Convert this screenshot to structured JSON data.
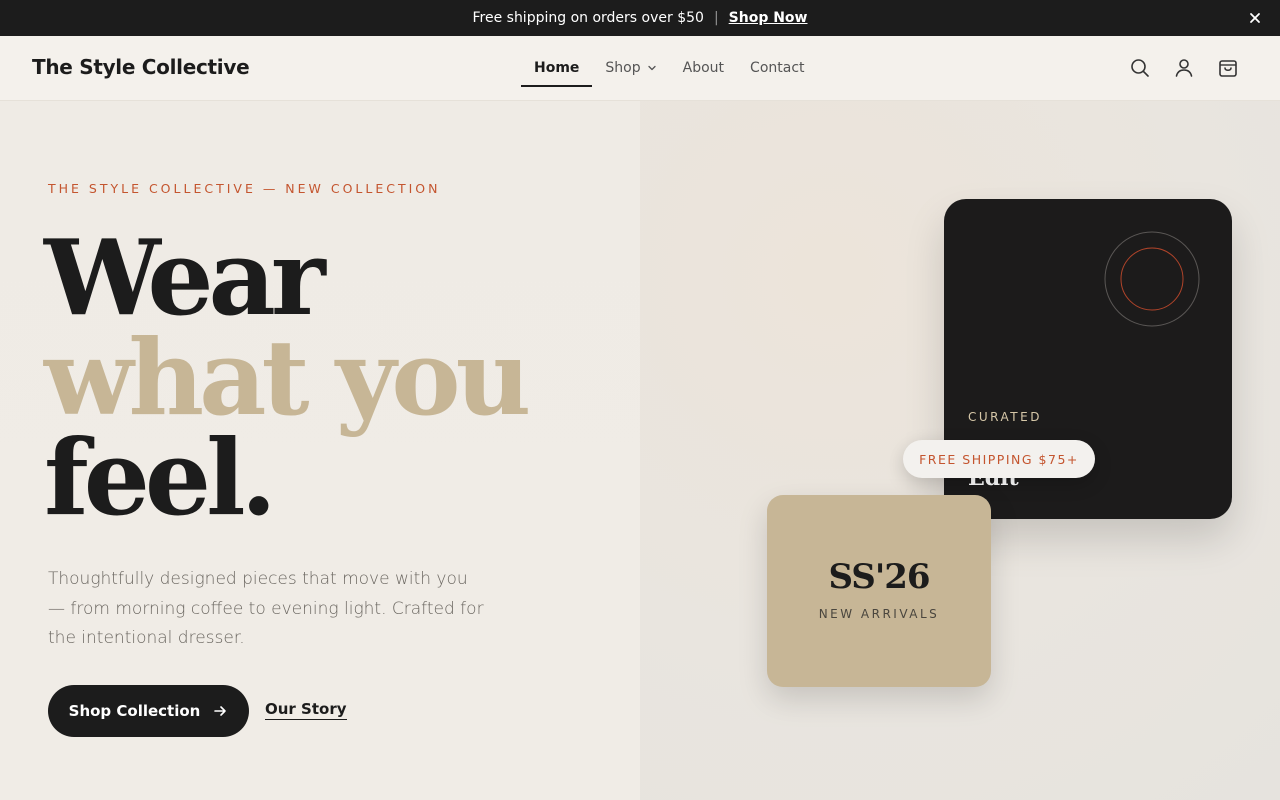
{
  "announcement": {
    "text": "Free shipping on orders over $50",
    "separator": "|",
    "link_label": "Shop Now"
  },
  "header": {
    "brand": "The Style Collective",
    "nav": [
      {
        "label": "Home",
        "active": true
      },
      {
        "label": "Shop",
        "has_dropdown": true
      },
      {
        "label": "About"
      },
      {
        "label": "Contact"
      }
    ],
    "icons": [
      "search-icon",
      "account-icon",
      "cart-icon"
    ]
  },
  "hero": {
    "eyebrow": "THE STYLE COLLECTIVE — NEW COLLECTION",
    "headline": {
      "line1": "Wear",
      "line2": "what you",
      "line3": "feel."
    },
    "subcopy": "Thoughtfully designed pieces that move with you — from morning coffee to evening light. Crafted for the intentional dresser.",
    "primary_cta": "Shop Collection",
    "secondary_cta": "Our Story"
  },
  "feature_cards": {
    "dark_card": {
      "label": "CURATED",
      "title": "Edit"
    },
    "pill": "FREE SHIPPING $75+",
    "tan_card": {
      "title": "SS'26",
      "subtitle": "NEW ARRIVALS"
    }
  },
  "colors": {
    "ink": "#1c1c1c",
    "accent": "#c4552f",
    "sand": "#c7b696",
    "background": "#f3f0eb"
  }
}
